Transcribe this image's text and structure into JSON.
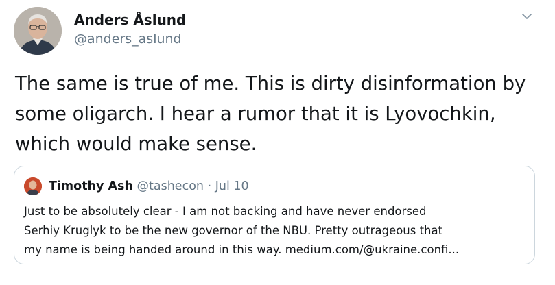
{
  "author": {
    "name": "Anders Åslund",
    "handle": "@anders_aslund"
  },
  "tweet_text": "The same is true of me. This is dirty disinformation by\nsome oligarch. I hear a rumor that it is Lyovochkin,\nwhich would make sense.",
  "quoted_tweet": {
    "name": "Timothy Ash",
    "handle": "@tashecon",
    "separator": "·",
    "date": "Jul 10",
    "text": "Just to be absolutely clear - I am not backing and have never endorsed\nSerhiy Kruglyk to be the new governor of the NBU. Pretty outrageous that\nmy name is being handed around in this way. medium.com/@ukraine.confi..."
  },
  "icons": {
    "menu": "chevron-down-icon"
  },
  "colors": {
    "text": "#14171a",
    "secondary": "#657786",
    "border": "#ccd6dd"
  }
}
